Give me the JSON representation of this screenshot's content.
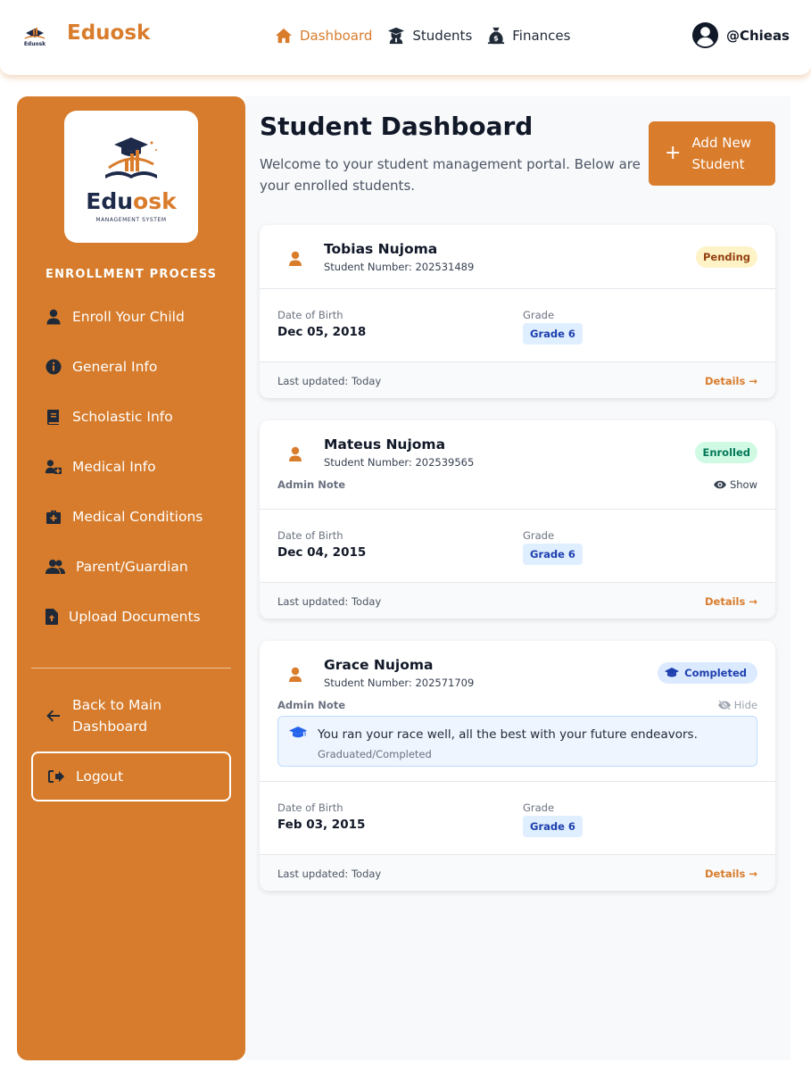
{
  "nav": {
    "brand": "Eduosk",
    "links": [
      {
        "label": "Dashboard",
        "icon": "home-icon"
      },
      {
        "label": "Students",
        "icon": "graduate-icon"
      },
      {
        "label": "Finances",
        "icon": "money-bag-icon"
      }
    ],
    "username": "@Chieas"
  },
  "sidebar": {
    "logo": {
      "name_part1": "Edu",
      "name_part2": "osk",
      "subtitle": "MANAGEMENT SYSTEM"
    },
    "section_title": "ENROLLMENT PROCESS",
    "items": [
      {
        "label": "Enroll Your Child",
        "icon": "user-icon"
      },
      {
        "label": "General Info",
        "icon": "info-circle-icon"
      },
      {
        "label": "Scholastic Info",
        "icon": "book-icon"
      },
      {
        "label": "Medical Info",
        "icon": "user-medical-icon"
      },
      {
        "label": "Medical Conditions",
        "icon": "medkit-icon"
      },
      {
        "label": "Parent/Guardian",
        "icon": "users-icon"
      },
      {
        "label": "Upload Documents",
        "icon": "file-upload-icon"
      }
    ],
    "back_label": "Back to Main Dashboard",
    "logout_label": "Logout"
  },
  "main": {
    "title": "Student Dashboard",
    "subtitle": "Welcome to your student management portal. Below are your enrolled students.",
    "add_button": "Add New Student",
    "students": [
      {
        "name": "Tobias Nujoma",
        "student_number": "Student Number: 202531489",
        "status": "Pending",
        "dob_label": "Date of Birth",
        "dob": "Dec 05, 2018",
        "grade_label": "Grade",
        "grade": "Grade 6",
        "updated": "Last updated: Today",
        "details": "Details →"
      },
      {
        "name": "Mateus Nujoma",
        "student_number": "Student Number: 202539565",
        "status": "Enrolled",
        "admin_note_label": "Admin Note",
        "note_toggle": "Show",
        "dob_label": "Date of Birth",
        "dob": "Dec 04, 2015",
        "grade_label": "Grade",
        "grade": "Grade 6",
        "updated": "Last updated: Today",
        "details": "Details →"
      },
      {
        "name": "Grace Nujoma",
        "student_number": "Student Number: 202571709",
        "status": "Completed",
        "admin_note_label": "Admin Note",
        "note_toggle": "Hide",
        "note_text": "You ran your race well, all the best with your future endeavors.",
        "note_status": "Graduated/Completed",
        "dob_label": "Date of Birth",
        "dob": "Feb 03, 2015",
        "grade_label": "Grade",
        "grade": "Grade 6",
        "updated": "Last updated: Today",
        "details": "Details →"
      }
    ]
  },
  "colors": {
    "accent": "#d97c2c",
    "sidebar": "#d67c2c",
    "navy": "#1e2a4a"
  }
}
